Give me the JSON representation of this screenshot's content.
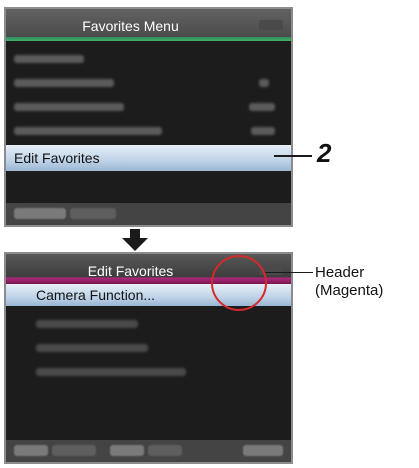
{
  "favorites_menu": {
    "title": "Favorites Menu",
    "selected_item": "Edit Favorites"
  },
  "edit_favorites_menu": {
    "title": "Edit Favorites",
    "selected_item": "Camera Function..."
  },
  "callout": {
    "step_number": "2"
  },
  "annotation": {
    "line1": "Header",
    "line2": "(Magenta)"
  },
  "colors": {
    "header_accent_favorites": "#3fae6a",
    "header_accent_edit": "#b02a80",
    "highlight_circle": "#d42a2a",
    "selection": "#bfd3e8"
  },
  "icons": {
    "transition": "down-arrow-icon"
  }
}
